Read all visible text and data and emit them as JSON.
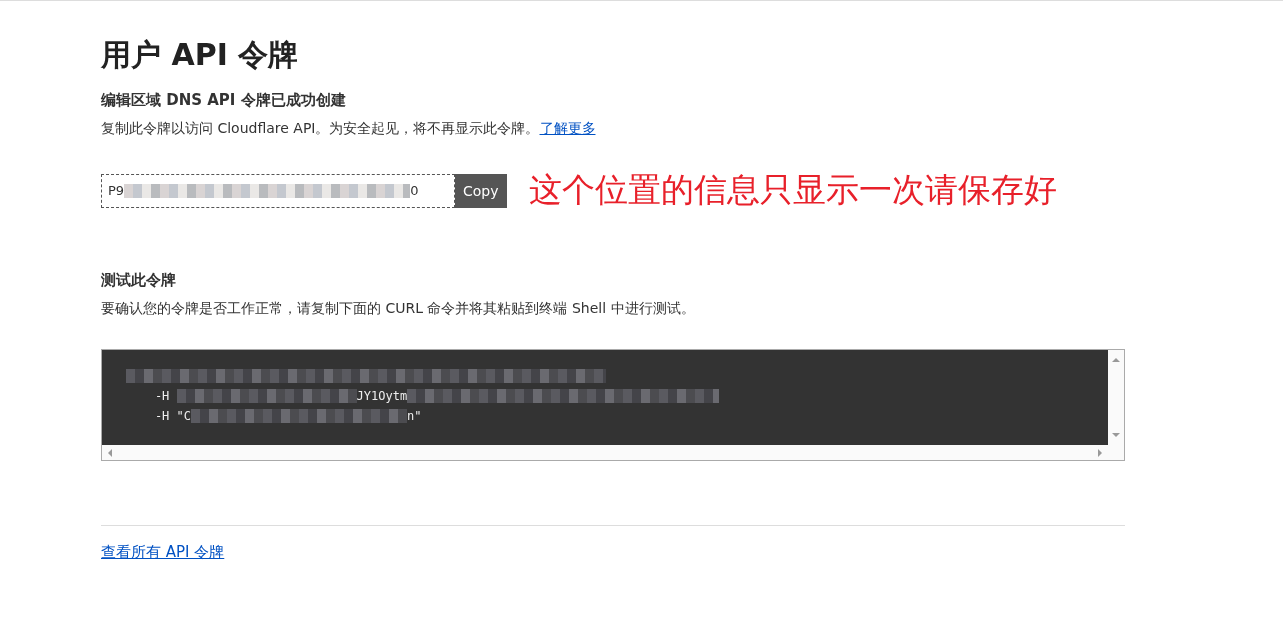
{
  "title": "用户 API 令牌",
  "created": {
    "heading": "编辑区域 DNS API 令牌已成功创建",
    "description": "复制此令牌以访问 Cloudflare API。为安全起见，将不再显示此令牌。",
    "link": "了解更多"
  },
  "token_field": {
    "segments": [
      {
        "kind": "text",
        "text": "P9"
      },
      {
        "kind": "blur"
      },
      {
        "kind": "text",
        "text": "0"
      }
    ],
    "copy_button": "Copy"
  },
  "annotation": "这个位置的信息只显示一次请保存好",
  "test": {
    "heading": "测试此令牌",
    "description": "要确认您的令牌是否工作正常，请复制下面的 CURL 命令并将其粘贴到终端 Shell 中进行测试。"
  },
  "code_lines": [
    {
      "segments": [
        {
          "kind": "blur"
        }
      ]
    },
    {
      "segments": [
        {
          "kind": "text",
          "text": "    -H "
        },
        {
          "kind": "blur"
        },
        {
          "kind": "text",
          "text": "JY1Oytm"
        },
        {
          "kind": "blur"
        }
      ]
    },
    {
      "segments": [
        {
          "kind": "text",
          "text": "    -H \"C"
        },
        {
          "kind": "blur"
        },
        {
          "kind": "text",
          "text": "n\""
        }
      ]
    }
  ],
  "footer_link": "查看所有 API 令牌"
}
